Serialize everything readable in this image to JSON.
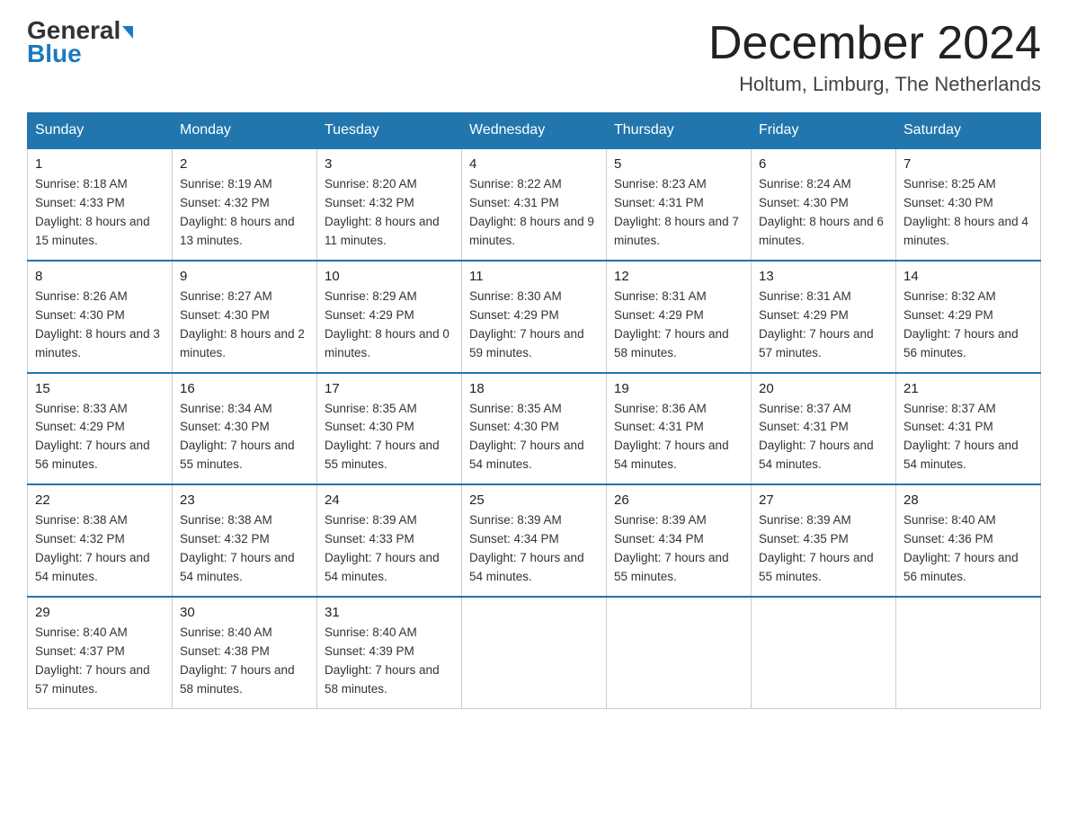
{
  "header": {
    "logo_general": "General",
    "logo_blue": "Blue",
    "month_title": "December 2024",
    "subtitle": "Holtum, Limburg, The Netherlands"
  },
  "columns": [
    "Sunday",
    "Monday",
    "Tuesday",
    "Wednesday",
    "Thursday",
    "Friday",
    "Saturday"
  ],
  "weeks": [
    [
      {
        "day": "1",
        "sunrise": "8:18 AM",
        "sunset": "4:33 PM",
        "daylight": "8 hours and 15 minutes."
      },
      {
        "day": "2",
        "sunrise": "8:19 AM",
        "sunset": "4:32 PM",
        "daylight": "8 hours and 13 minutes."
      },
      {
        "day": "3",
        "sunrise": "8:20 AM",
        "sunset": "4:32 PM",
        "daylight": "8 hours and 11 minutes."
      },
      {
        "day": "4",
        "sunrise": "8:22 AM",
        "sunset": "4:31 PM",
        "daylight": "8 hours and 9 minutes."
      },
      {
        "day": "5",
        "sunrise": "8:23 AM",
        "sunset": "4:31 PM",
        "daylight": "8 hours and 7 minutes."
      },
      {
        "day": "6",
        "sunrise": "8:24 AM",
        "sunset": "4:30 PM",
        "daylight": "8 hours and 6 minutes."
      },
      {
        "day": "7",
        "sunrise": "8:25 AM",
        "sunset": "4:30 PM",
        "daylight": "8 hours and 4 minutes."
      }
    ],
    [
      {
        "day": "8",
        "sunrise": "8:26 AM",
        "sunset": "4:30 PM",
        "daylight": "8 hours and 3 minutes."
      },
      {
        "day": "9",
        "sunrise": "8:27 AM",
        "sunset": "4:30 PM",
        "daylight": "8 hours and 2 minutes."
      },
      {
        "day": "10",
        "sunrise": "8:29 AM",
        "sunset": "4:29 PM",
        "daylight": "8 hours and 0 minutes."
      },
      {
        "day": "11",
        "sunrise": "8:30 AM",
        "sunset": "4:29 PM",
        "daylight": "7 hours and 59 minutes."
      },
      {
        "day": "12",
        "sunrise": "8:31 AM",
        "sunset": "4:29 PM",
        "daylight": "7 hours and 58 minutes."
      },
      {
        "day": "13",
        "sunrise": "8:31 AM",
        "sunset": "4:29 PM",
        "daylight": "7 hours and 57 minutes."
      },
      {
        "day": "14",
        "sunrise": "8:32 AM",
        "sunset": "4:29 PM",
        "daylight": "7 hours and 56 minutes."
      }
    ],
    [
      {
        "day": "15",
        "sunrise": "8:33 AM",
        "sunset": "4:29 PM",
        "daylight": "7 hours and 56 minutes."
      },
      {
        "day": "16",
        "sunrise": "8:34 AM",
        "sunset": "4:30 PM",
        "daylight": "7 hours and 55 minutes."
      },
      {
        "day": "17",
        "sunrise": "8:35 AM",
        "sunset": "4:30 PM",
        "daylight": "7 hours and 55 minutes."
      },
      {
        "day": "18",
        "sunrise": "8:35 AM",
        "sunset": "4:30 PM",
        "daylight": "7 hours and 54 minutes."
      },
      {
        "day": "19",
        "sunrise": "8:36 AM",
        "sunset": "4:31 PM",
        "daylight": "7 hours and 54 minutes."
      },
      {
        "day": "20",
        "sunrise": "8:37 AM",
        "sunset": "4:31 PM",
        "daylight": "7 hours and 54 minutes."
      },
      {
        "day": "21",
        "sunrise": "8:37 AM",
        "sunset": "4:31 PM",
        "daylight": "7 hours and 54 minutes."
      }
    ],
    [
      {
        "day": "22",
        "sunrise": "8:38 AM",
        "sunset": "4:32 PM",
        "daylight": "7 hours and 54 minutes."
      },
      {
        "day": "23",
        "sunrise": "8:38 AM",
        "sunset": "4:32 PM",
        "daylight": "7 hours and 54 minutes."
      },
      {
        "day": "24",
        "sunrise": "8:39 AM",
        "sunset": "4:33 PM",
        "daylight": "7 hours and 54 minutes."
      },
      {
        "day": "25",
        "sunrise": "8:39 AM",
        "sunset": "4:34 PM",
        "daylight": "7 hours and 54 minutes."
      },
      {
        "day": "26",
        "sunrise": "8:39 AM",
        "sunset": "4:34 PM",
        "daylight": "7 hours and 55 minutes."
      },
      {
        "day": "27",
        "sunrise": "8:39 AM",
        "sunset": "4:35 PM",
        "daylight": "7 hours and 55 minutes."
      },
      {
        "day": "28",
        "sunrise": "8:40 AM",
        "sunset": "4:36 PM",
        "daylight": "7 hours and 56 minutes."
      }
    ],
    [
      {
        "day": "29",
        "sunrise": "8:40 AM",
        "sunset": "4:37 PM",
        "daylight": "7 hours and 57 minutes."
      },
      {
        "day": "30",
        "sunrise": "8:40 AM",
        "sunset": "4:38 PM",
        "daylight": "7 hours and 58 minutes."
      },
      {
        "day": "31",
        "sunrise": "8:40 AM",
        "sunset": "4:39 PM",
        "daylight": "7 hours and 58 minutes."
      },
      null,
      null,
      null,
      null
    ]
  ]
}
